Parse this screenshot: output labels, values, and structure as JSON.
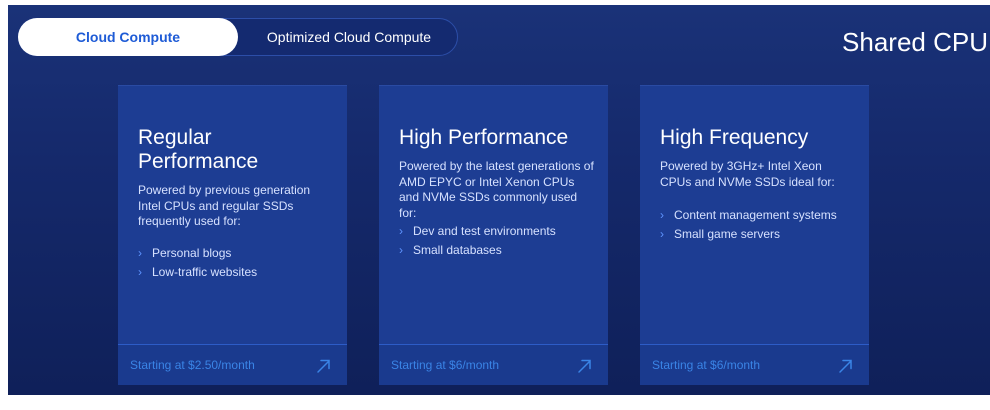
{
  "tabs": [
    {
      "label": "Cloud Compute",
      "active": true
    },
    {
      "label": "Optimized Cloud Compute",
      "active": false
    }
  ],
  "section_title": "Shared CPU",
  "cards": [
    {
      "title": "Regular Performance",
      "description": "Powered by previous generation Intel CPUs and regular SSDs frequently used for:",
      "items": [
        "Personal blogs",
        "Low-traffic websites"
      ],
      "price": "Starting at $2.50/month"
    },
    {
      "title": "High Performance",
      "description": "Powered by the latest generations of AMD EPYC or Intel Xenon CPUs and NVMe SSDs commonly used for:",
      "items": [
        "Dev and test environments",
        "Small databases"
      ],
      "price": "Starting at $6/month"
    },
    {
      "title": "High Frequency",
      "description": "Powered by 3GHz+ Intel Xeon CPUs and NVMe SSDs ideal for:",
      "items": [
        "Content management systems",
        "Small game servers"
      ],
      "price": "Starting at $6/month"
    }
  ],
  "icons": {
    "chevron": "chevron-right-icon",
    "arrow": "arrow-up-right-icon"
  },
  "colors": {
    "accent": "#3a84e6",
    "background": "#15296b",
    "card": "#1d3d93",
    "active_tab_text": "#1e5bd6"
  }
}
